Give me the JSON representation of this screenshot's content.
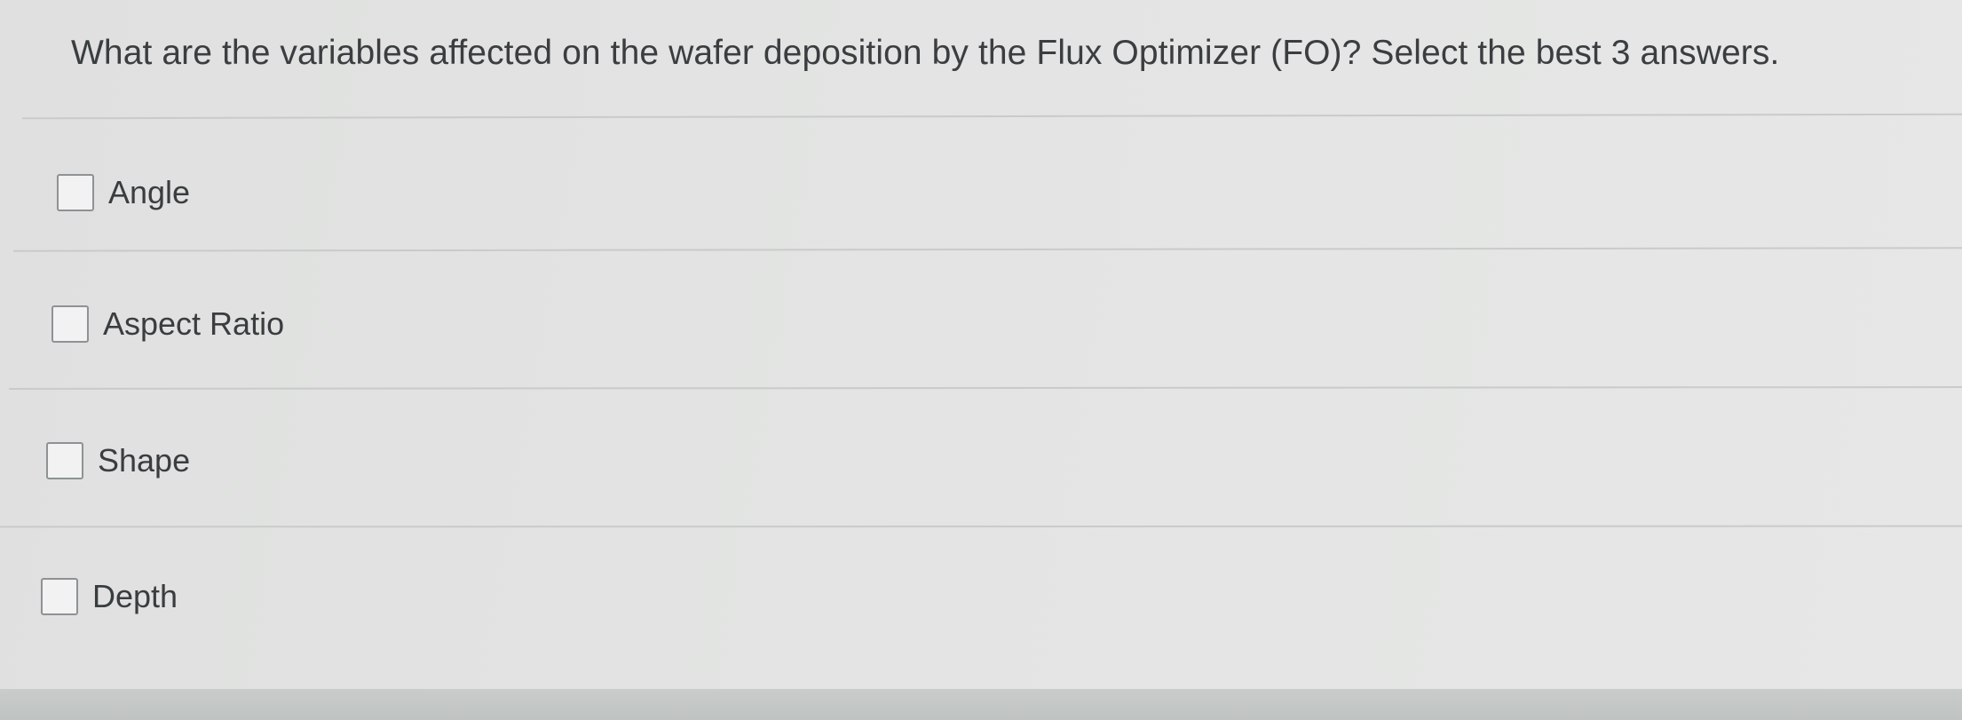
{
  "question": {
    "text": "What are the variables affected on the wafer deposition by the Flux Optimizer (FO)? Select the best 3 answers."
  },
  "options": [
    {
      "label": "Angle",
      "checked": false
    },
    {
      "label": "Aspect Ratio",
      "checked": false
    },
    {
      "label": "Shape",
      "checked": false
    },
    {
      "label": "Depth",
      "checked": false
    }
  ]
}
